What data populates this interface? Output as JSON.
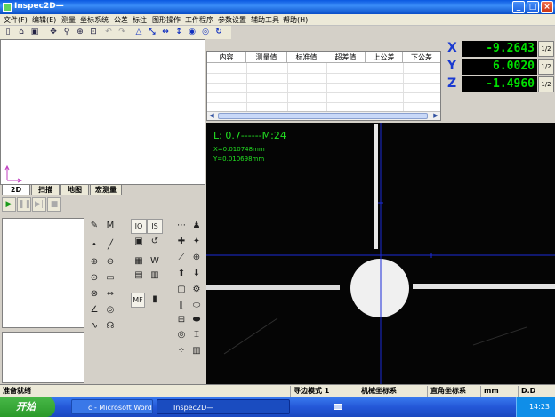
{
  "window": {
    "title": "Inspec2D—",
    "buttons": {
      "minimize": "_",
      "maximize": "□",
      "close": "×"
    }
  },
  "menu": {
    "items": [
      "文件(F)",
      "编辑(E)",
      "测量",
      "坐标系统",
      "公差",
      "标注",
      "图形操作",
      "工件程序",
      "参数设置",
      "辅助工具",
      "帮助(H)"
    ]
  },
  "toolbar": {
    "icons": [
      "new-file-icon",
      "open-folder-icon",
      "save-icon",
      "move-icon",
      "zoom-in-icon",
      "zoom-window-icon",
      "zoom-fit-icon",
      "undo-icon",
      "redo-icon",
      "level-icon",
      "rotate-icon",
      "h-dimension-icon",
      "v-dimension-icon",
      "circle-center-icon",
      "refresh-icon",
      "redo-arrow-icon"
    ]
  },
  "left_tabs": [
    "2D",
    "扫描",
    "地图",
    "宏测量"
  ],
  "playback": {
    "play": "▶",
    "pause": "❚❚",
    "step": "▶|",
    "stop": "■"
  },
  "measure_table": {
    "columns": [
      "内容",
      "测量值",
      "标准值",
      "超差值",
      "上公差",
      "下公差"
    ]
  },
  "coordinates": {
    "x": {
      "label": "X",
      "value": "-9.2643",
      "scale": "1/2"
    },
    "y": {
      "label": "Y",
      "value": "6.0020",
      "scale": "1/2"
    },
    "z": {
      "label": "Z",
      "value": "-1.4960",
      "scale": "1/2"
    }
  },
  "video_overlay": {
    "lens": "L: 0.7------M:24",
    "pixel_x": "X=0.010748mm",
    "pixel_y": "Y=0.010698mm"
  },
  "palette_labels": {
    "m_button": "M",
    "mf_button": "MF",
    "io": "IO",
    "is": "IS"
  },
  "status_bar": {
    "message": "准备就绪",
    "edge_mode": "寻边模式 1",
    "machine_coord": "机械坐标系",
    "rect_coord": "直角坐标系",
    "unit": "mm",
    "dd": "D.D"
  },
  "taskbar": {
    "start": "开始",
    "tasks": [
      "c - Microsoft Word",
      "Inspec2D—"
    ],
    "clock": "14:23"
  },
  "colors": {
    "readout_bg": "#000000",
    "readout_fg": "#00e000",
    "overlay_text": "#22e022",
    "crosshair": "#1a2ad8"
  }
}
